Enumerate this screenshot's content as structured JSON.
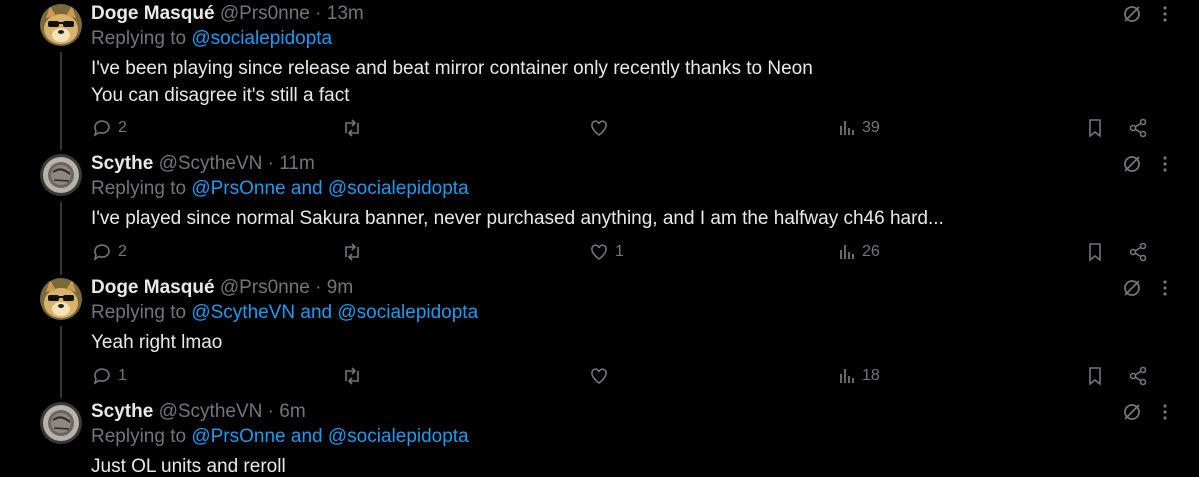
{
  "tweets": [
    {
      "name": "Doge Masqué",
      "handle": "@Prs0nne",
      "time": "13m",
      "replying_prefix": "Replying to",
      "replying_to": [
        "@socialepidopta"
      ],
      "replying_joiner": "",
      "lines": [
        "I've been playing since release and beat mirror container only recently thanks to Neon",
        "You can disagree it's still a fact"
      ],
      "replies": "2",
      "reposts": "",
      "likes": "",
      "views": "39",
      "avatar": "doge"
    },
    {
      "name": "Scythe",
      "handle": "@ScytheVN",
      "time": "11m",
      "replying_prefix": "Replying to",
      "replying_to": [
        "@PrsOnne",
        "@socialepidopta"
      ],
      "replying_joiner": "and",
      "lines": [
        "I've played since normal Sakura banner, never purchased anything, and I am the halfway ch46 hard..."
      ],
      "replies": "2",
      "reposts": "",
      "likes": "1",
      "views": "26",
      "avatar": "scythe"
    },
    {
      "name": "Doge Masqué",
      "handle": "@Prs0nne",
      "time": "9m",
      "replying_prefix": "Replying to",
      "replying_to": [
        "@ScytheVN",
        "@socialepidopta"
      ],
      "replying_joiner": "and",
      "lines": [
        "Yeah right lmao"
      ],
      "replies": "1",
      "reposts": "",
      "likes": "",
      "views": "18",
      "avatar": "doge"
    },
    {
      "name": "Scythe",
      "handle": "@ScytheVN",
      "time": "6m",
      "replying_prefix": "Replying to",
      "replying_to": [
        "@PrsOnne",
        "@socialepidopta"
      ],
      "replying_joiner": "and",
      "lines": [
        "Just OL units and reroll"
      ],
      "replies": "",
      "reposts": "",
      "likes": "",
      "views": "",
      "avatar": "scythe"
    }
  ],
  "sep": "·",
  "icons": {
    "reply": "reply-icon",
    "repost": "repost-icon",
    "like": "like-icon",
    "views": "views-icon",
    "bookmark": "bookmark-icon",
    "share": "share-icon",
    "grok": "grok-icon",
    "more": "more-icon"
  },
  "colors": {
    "background": "#000000",
    "text": "#e7e9ea",
    "muted": "#71767b",
    "link": "#1d9bf0"
  }
}
